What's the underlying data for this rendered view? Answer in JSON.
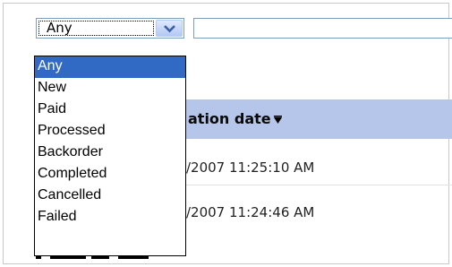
{
  "filter": {
    "selected_value": "Any",
    "text_value": ""
  },
  "dropdown": {
    "options": [
      "Any",
      "New",
      "Paid",
      "Processed",
      "Backorder",
      "Completed",
      "Cancelled",
      "Failed"
    ],
    "highlighted": "Any"
  },
  "table": {
    "header_label": "ation date",
    "sort_icon": "sort-descending-icon",
    "rows": [
      {
        "date": "/2007 11:25:10 AM"
      },
      {
        "date": "/2007 11:24:46 AM"
      }
    ]
  },
  "colors": {
    "highlight": "#316ac5",
    "header_bg": "#b6c6eb",
    "input_border": "#7f9db9"
  }
}
